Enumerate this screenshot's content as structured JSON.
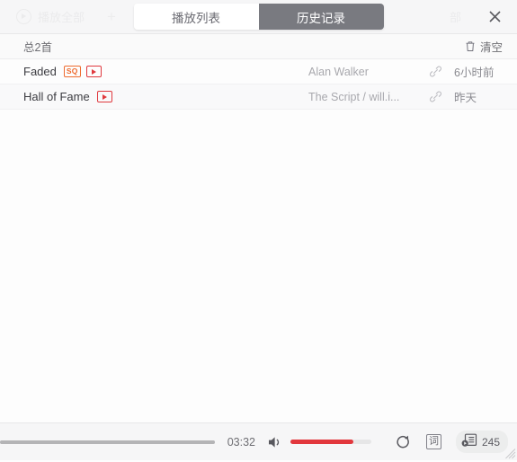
{
  "header": {
    "ghost_play_all": "播放全部",
    "ghost_plus": "+",
    "ghost_right": "部",
    "tabs": [
      {
        "label": "播放列表",
        "active": false
      },
      {
        "label": "历史记录",
        "active": true
      }
    ],
    "close_icon": "close-icon"
  },
  "subheader": {
    "total": "总2首",
    "clear_label": "清空",
    "clear_icon": "trash-icon"
  },
  "list": {
    "rows": [
      {
        "title": "Faded",
        "badges": [
          "SQ",
          "MV"
        ],
        "artist": "Alan Walker",
        "link_icon": "link-icon",
        "time": "6小时前"
      },
      {
        "title": "Hall of Fame",
        "badges": [
          "MV"
        ],
        "artist": "The Script / will.i...",
        "link_icon": "link-icon",
        "time": "昨天"
      }
    ]
  },
  "player": {
    "progress_percent": 100,
    "time": "03:32",
    "volume_icon": "volume-icon",
    "volume_percent": 78,
    "repeat_icon": "repeat-icon",
    "lyrics_label": "词",
    "playlist_icon": "playlist-icon",
    "playlist_count": "245"
  },
  "colors": {
    "accent_red": "#e2373d",
    "badge_sq": "#ee6b2f",
    "badge_mv": "#e0393e",
    "tab_active_bg": "#797a80",
    "header_bg": "#f6f6f7"
  }
}
